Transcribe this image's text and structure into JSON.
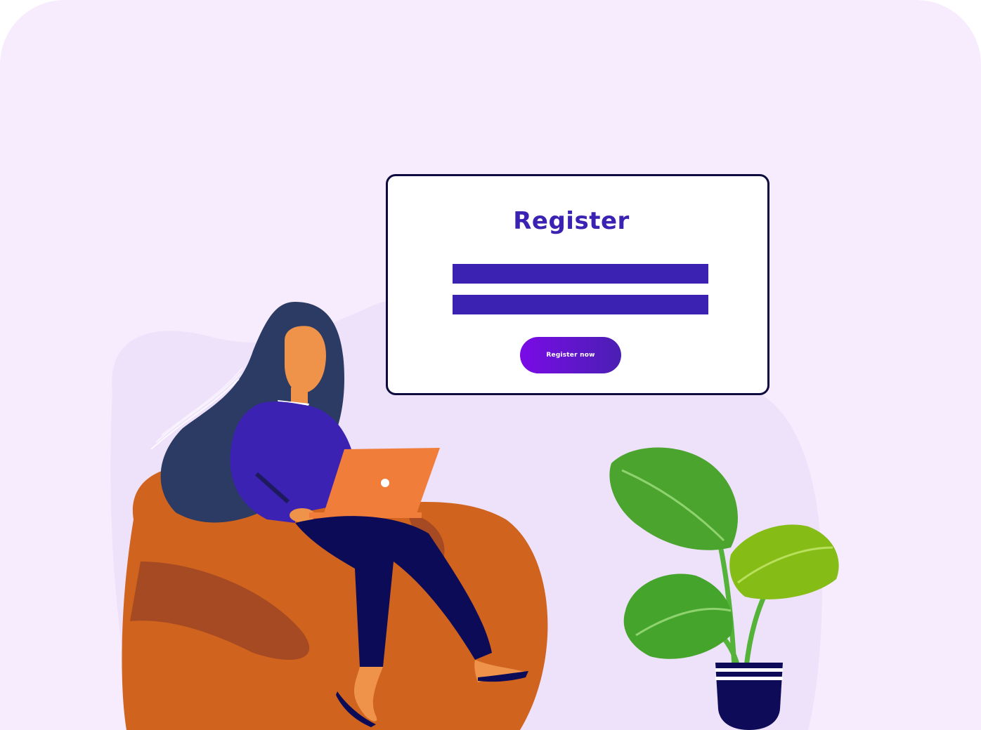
{
  "card": {
    "title": "Register",
    "button_label": "Register now"
  },
  "colors": {
    "background": "#F6ECFD",
    "blob": "#EEE1FA",
    "accent": "#3B22B3",
    "button_start": "#7A0BE6",
    "button_end": "#4A1FB3",
    "card_border": "#0E0B3F"
  },
  "illustration": {
    "icons": [
      "woman-on-beanbag-illustration",
      "laptop-icon",
      "potted-plant-illustration"
    ]
  }
}
